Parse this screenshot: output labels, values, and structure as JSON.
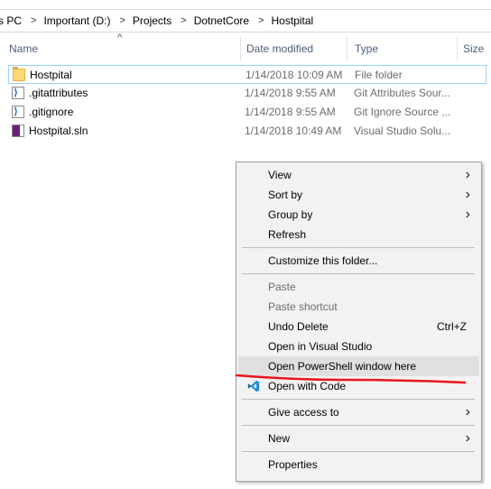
{
  "address": {
    "crumbs": [
      "s PC",
      "Important (D:)",
      "Projects",
      "DotnetCore",
      "Hostpital"
    ],
    "separator": ">"
  },
  "columns": {
    "name": "Name",
    "date": "Date modified",
    "type": "Type",
    "size": "Size",
    "sort_glyph": "^"
  },
  "files": [
    {
      "name": "Hostpital",
      "date": "1/14/2018 10:09 AM",
      "type": "File folder",
      "icon": "folder-icon"
    },
    {
      "name": ".gitattributes",
      "date": "1/14/2018 9:55 AM",
      "type": "Git Attributes Sour...",
      "icon": "vs-file-icon"
    },
    {
      "name": ".gitignore",
      "date": "1/14/2018 9:55 AM",
      "type": "Git Ignore Source ...",
      "icon": "vs-file-icon"
    },
    {
      "name": "Hostpital.sln",
      "date": "1/14/2018 10:49 AM",
      "type": "Visual Studio Solu...",
      "icon": "sln-icon"
    }
  ],
  "menu": {
    "view": "View",
    "sort_by": "Sort by",
    "group_by": "Group by",
    "refresh": "Refresh",
    "customize": "Customize this folder...",
    "paste": "Paste",
    "paste_shortcut": "Paste shortcut",
    "undo_delete": "Undo Delete",
    "undo_shortcut": "Ctrl+Z",
    "open_vs": "Open in Visual Studio",
    "open_powershell": "Open PowerShell window here",
    "open_code": "Open with Code",
    "give_access": "Give access to",
    "new": "New",
    "properties": "Properties",
    "submenu_arrow": "›"
  },
  "colors": {
    "selection_border": "#99d1ff",
    "menu_bg": "#f2f2f2",
    "menu_hover": "#e0e0e0",
    "annotation_red": "#e8141c",
    "vscode_blue": "#1e8ad6"
  }
}
